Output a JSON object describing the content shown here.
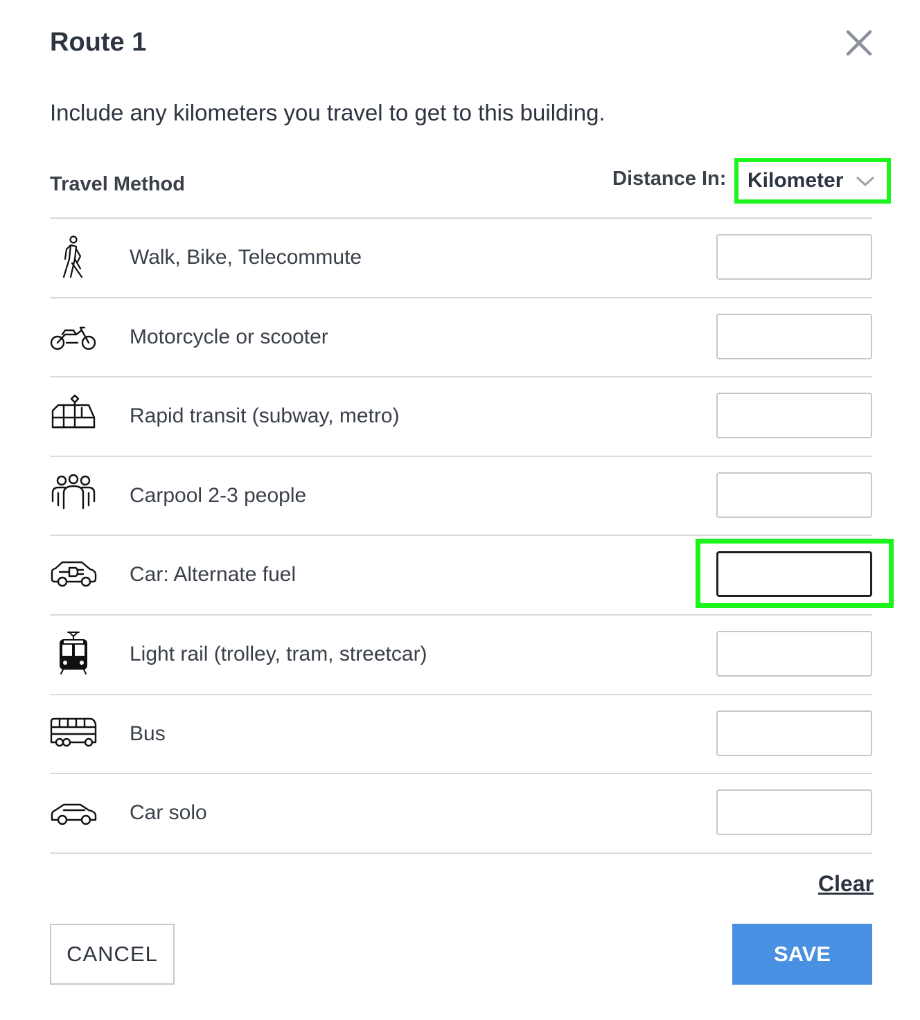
{
  "dialog": {
    "title": "Route 1",
    "intro": "Include any kilometers you travel to get to this building.",
    "column_header": "Travel Method",
    "distance_label": "Distance In:",
    "unit_value": "Kilometer"
  },
  "methods": [
    {
      "icon": "walking-person-icon",
      "label": "Walk, Bike, Telecommute",
      "value": ""
    },
    {
      "icon": "motorcycle-icon",
      "label": "Motorcycle or scooter",
      "value": ""
    },
    {
      "icon": "rapid-transit-icon",
      "label": "Rapid transit (subway, metro)",
      "value": ""
    },
    {
      "icon": "people-group-icon",
      "label": "Carpool 2-3 people",
      "value": ""
    },
    {
      "icon": "electric-car-icon",
      "label": "Car: Alternate fuel",
      "value": ""
    },
    {
      "icon": "tram-icon",
      "label": "Light rail (trolley, tram, streetcar)",
      "value": ""
    },
    {
      "icon": "bus-icon",
      "label": "Bus",
      "value": ""
    },
    {
      "icon": "car-icon",
      "label": "Car solo",
      "value": ""
    }
  ],
  "actions": {
    "clear": "Clear",
    "cancel": "CANCEL",
    "save": "SAVE"
  },
  "colors": {
    "save_button": "#4a90e2",
    "highlight": "#1cf51c",
    "text": "#2c3440"
  }
}
